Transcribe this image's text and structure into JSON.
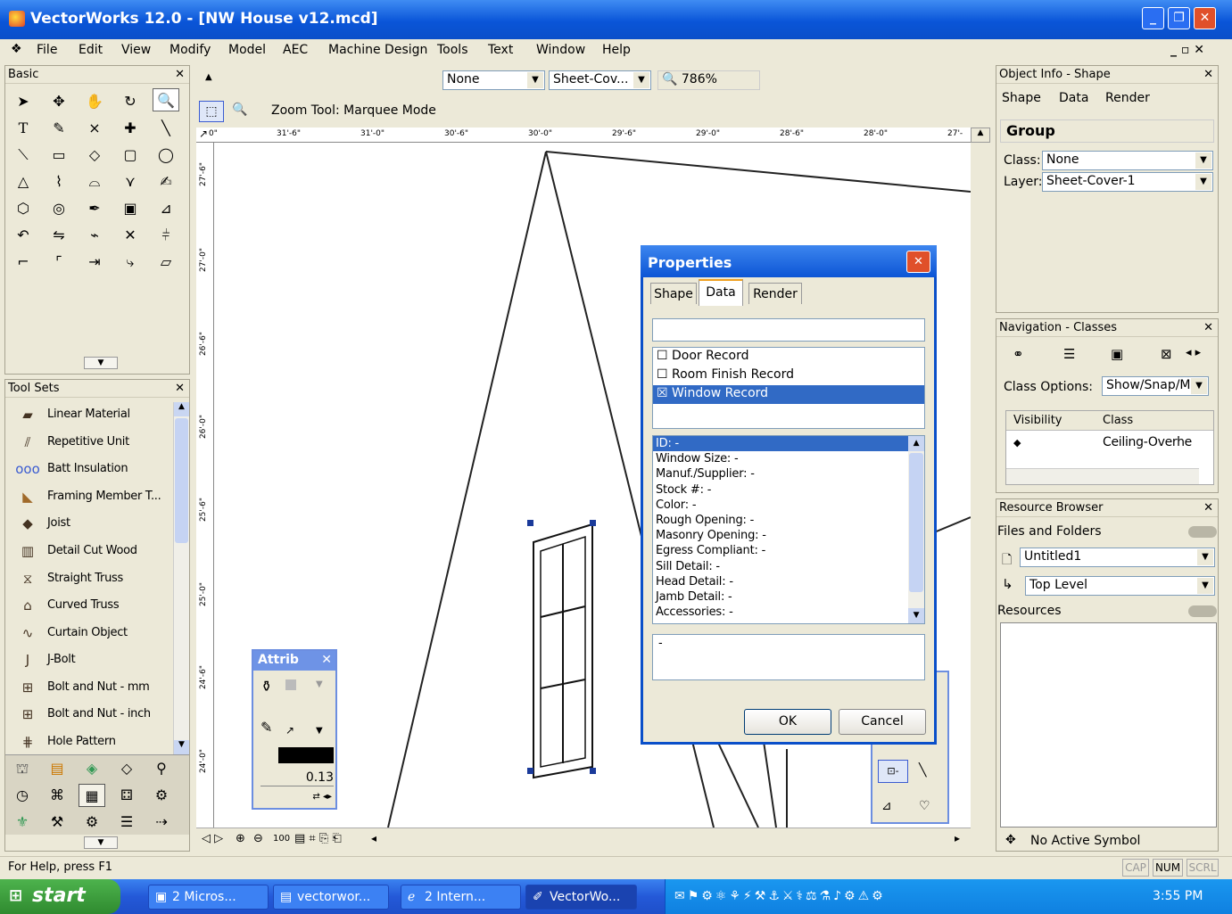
{
  "window": {
    "title": "VectorWorks 12.0 - [NW House v12.mcd]"
  },
  "menu": [
    "File",
    "Edit",
    "View",
    "Modify",
    "Model",
    "AEC",
    "Machine Design",
    "Tools",
    "Text",
    "Window",
    "Help"
  ],
  "basic_palette": {
    "title": "Basic"
  },
  "tool_sets": {
    "title": "Tool Sets",
    "items": [
      "Linear Material",
      "Repetitive Unit",
      "Batt Insulation",
      "Framing Member T...",
      "Joist",
      "Detail Cut Wood",
      "Straight Truss",
      "Curved Truss",
      "Curtain Object",
      "J-Bolt",
      "Bolt and Nut - mm",
      "Bolt and Nut - inch",
      "Hole Pattern"
    ]
  },
  "view_bar": {
    "class_value": "None",
    "layer_value": "Sheet-Cov...",
    "zoom": "786%",
    "mode_text": "Zoom Tool: Marquee Mode"
  },
  "ruler": {
    "h_ticks": [
      "0\"",
      "31'-6\"",
      "31'-0\"",
      "30'-6\"",
      "30'-0\"",
      "29'-6\"",
      "29'-0\"",
      "28'-6\"",
      "28'-0\"",
      "27'-"
    ],
    "v_ticks": [
      "27'-6\"",
      "27'-0\"",
      "26'-6\"",
      "26'-0\"",
      "25'-6\"",
      "25'-0\"",
      "24'-6\"",
      "24'-0\""
    ]
  },
  "attrib": {
    "title": "Attrib",
    "line_weight": "0.13"
  },
  "properties": {
    "title": "Properties",
    "tabs": [
      "Shape",
      "Data",
      "Render"
    ],
    "records": [
      {
        "label": "Door Record",
        "checked": false
      },
      {
        "label": "Room Finish Record",
        "checked": false
      },
      {
        "label": "Window Record",
        "checked": true
      }
    ],
    "fields": [
      "ID: -",
      "Window Size: -",
      "Manuf./Supplier: -",
      "Stock #: -",
      "Color: -",
      "Rough Opening: -",
      "Masonry Opening: -",
      "Egress Compliant: -",
      "Sill Detail: -",
      "Head Detail: -",
      "Jamb Detail: -",
      "Accessories: -"
    ],
    "value_text": "-",
    "ok": "OK",
    "cancel": "Cancel"
  },
  "object_info": {
    "title": "Object Info - Shape",
    "tabs": [
      "Shape",
      "Data",
      "Render"
    ],
    "object_type": "Group",
    "class_label": "Class:",
    "class_value": "None",
    "layer_label": "Layer:",
    "layer_value": "Sheet-Cover-1"
  },
  "navigation": {
    "title": "Navigation - Classes",
    "class_options_label": "Class Options:",
    "class_options_value": "Show/Snap/M",
    "col_visibility": "Visibility",
    "col_class": "Class",
    "row_class": "Ceiling-Overhe"
  },
  "resource_browser": {
    "title": "Resource Browser",
    "files_label": "Files and Folders",
    "file_value": "Untitled1",
    "folder_value": "Top Level",
    "resources_label": "Resources",
    "no_symbol": "No Active Symbol"
  },
  "status": {
    "help": "For Help, press F1",
    "cap": "CAP",
    "num": "NUM",
    "scrl": "SCRL"
  },
  "zoom_bar": {
    "label": "100"
  },
  "taskbar": {
    "start": "start",
    "tasks": [
      "2 Micros...",
      "vectorwor...",
      "2 Intern...",
      "VectorWo..."
    ],
    "time": "3:55 PM"
  }
}
